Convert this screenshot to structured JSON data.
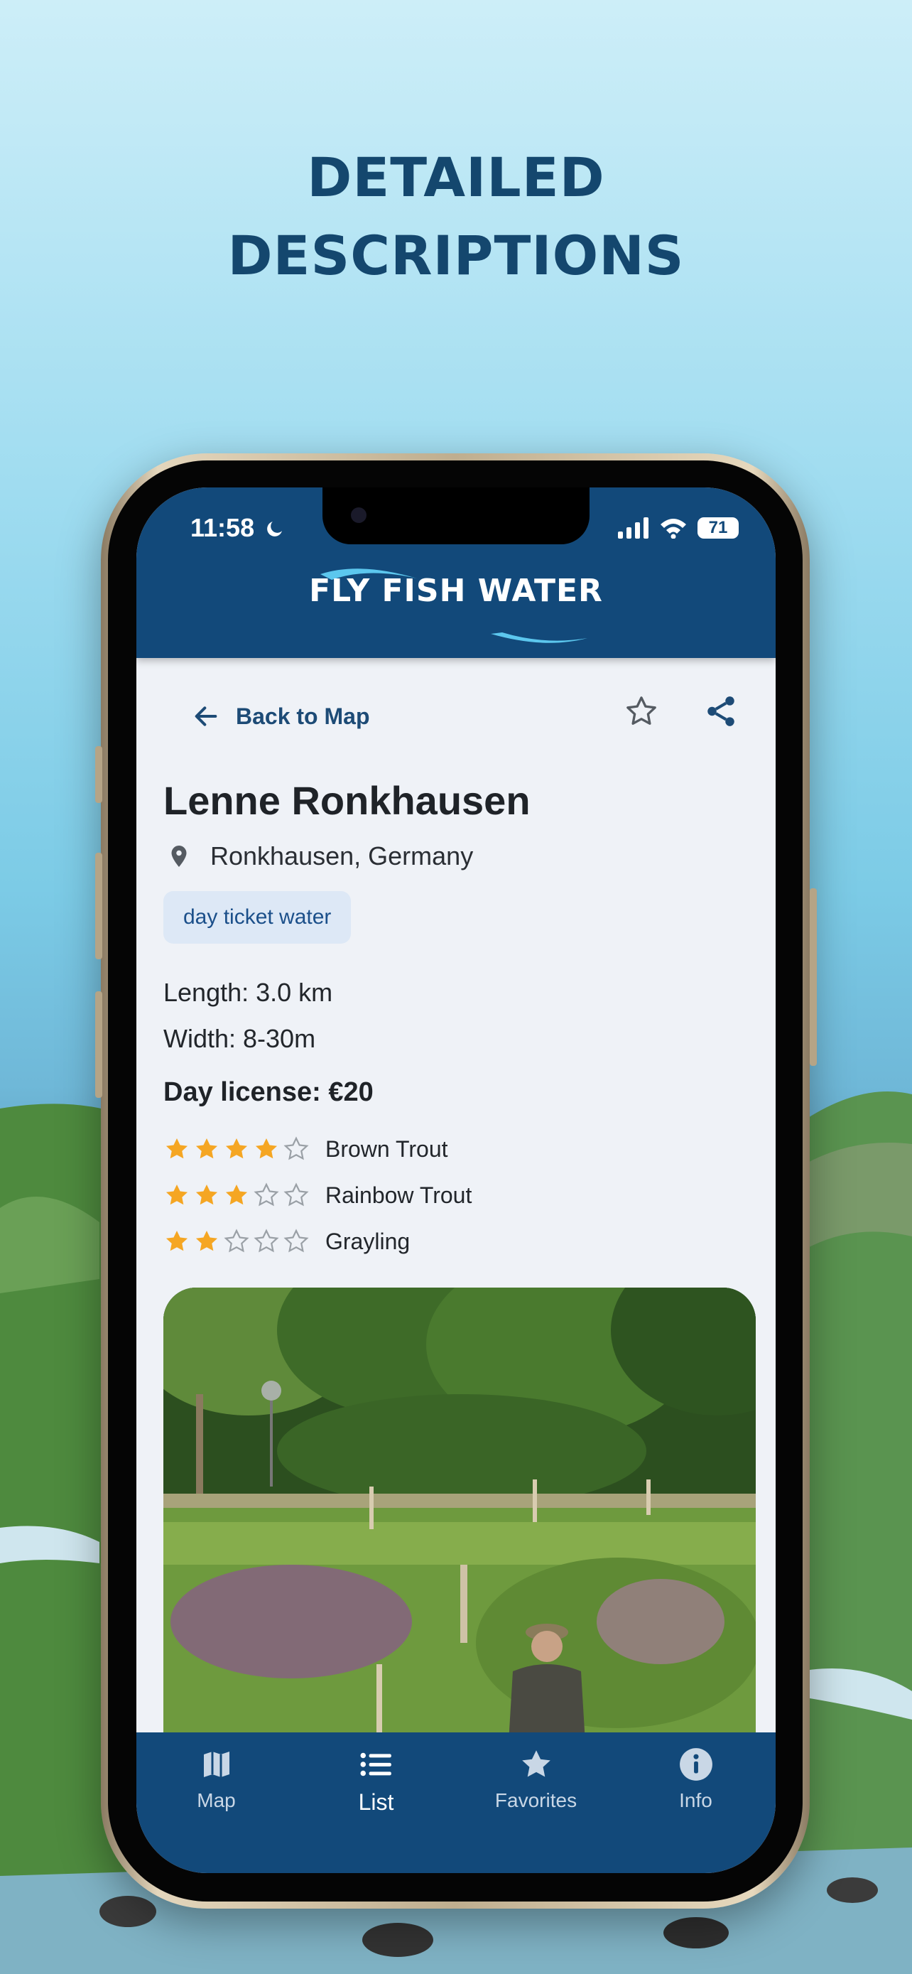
{
  "promo": {
    "headline_line1": "DETAILED",
    "headline_line2": "DESCRIPTIONS"
  },
  "status_bar": {
    "time": "11:58",
    "battery": "71"
  },
  "app": {
    "logo_text": "FLY FISH WATER"
  },
  "detail": {
    "back_label": "Back to Map",
    "title": "Lenne Ronkhausen",
    "location": "Ronkhausen, Germany",
    "tag": "day ticket water",
    "length": "Length: 3.0 km",
    "width": "Width: 8-30m",
    "license": "Day license: €20",
    "ratings": [
      {
        "species": "Brown Trout",
        "stars": 4,
        "max": 5
      },
      {
        "species": "Rainbow Trout",
        "stars": 3,
        "max": 5
      },
      {
        "species": "Grayling",
        "stars": 2,
        "max": 5
      }
    ]
  },
  "tabs": [
    {
      "label": "Map",
      "icon": "map-icon"
    },
    {
      "label": "List",
      "icon": "list-icon",
      "active": true
    },
    {
      "label": "Favorites",
      "icon": "star-icon"
    },
    {
      "label": "Info",
      "icon": "info-icon"
    }
  ],
  "colors": {
    "brand": "#12497a",
    "headline": "#14476e",
    "star_filled": "#f5a623",
    "star_empty": "#9aa0a6",
    "tag_bg": "#dde8f6"
  }
}
